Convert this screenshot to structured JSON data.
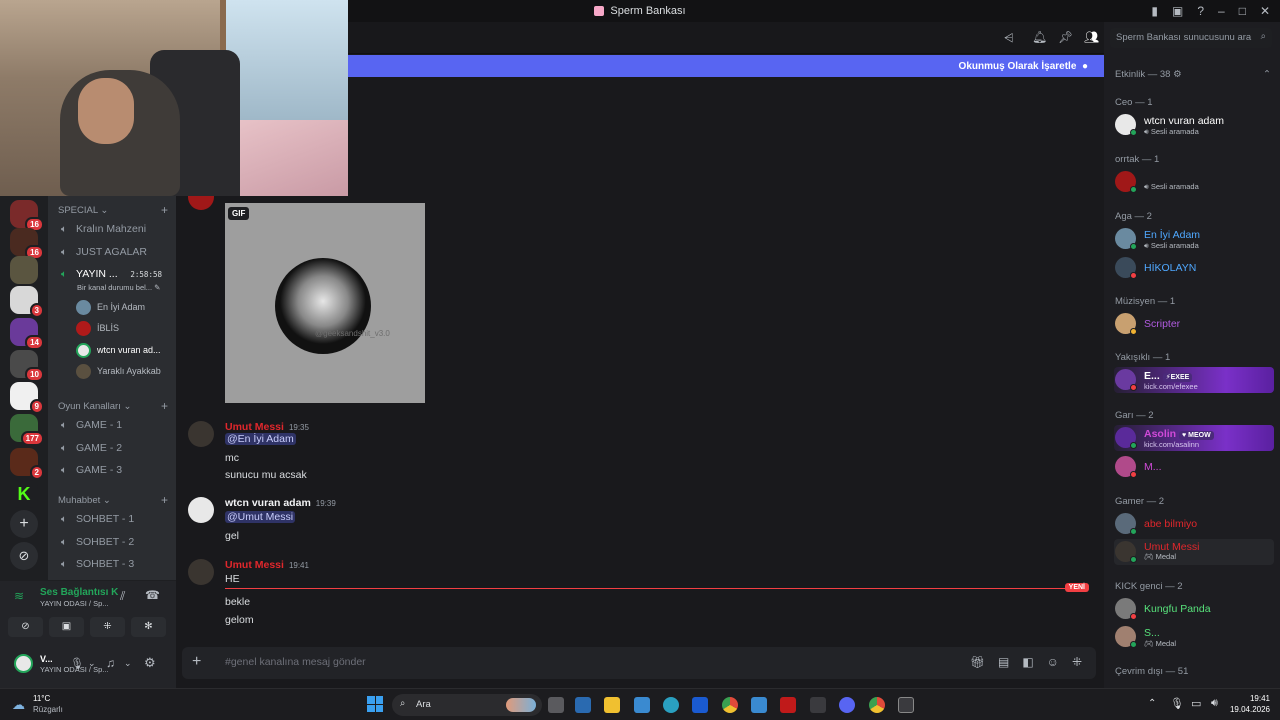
{
  "window": {
    "title": "Sperm Bankası"
  },
  "topbar": {
    "unread_banner": "Okunmuş Olarak İşaretle"
  },
  "servers": [
    {
      "badge": "16"
    },
    {
      "badge": "16"
    },
    {
      "badge": ""
    },
    {
      "badge": "3"
    },
    {
      "badge": "14"
    },
    {
      "badge": "10"
    },
    {
      "badge": "9"
    },
    {
      "badge": "177"
    },
    {
      "badge": "2"
    }
  ],
  "channels": {
    "cat_special": "SPECIAL",
    "kralin": "Kralın Mahzeni",
    "just": "JUST AGALAR",
    "yayin": "YAYIN ...",
    "yayin_time": "2:58:58",
    "yayin_status": "Bir kanal durumu bel...",
    "voice_users": [
      "En İyi Adam",
      "İBLİS",
      "wtcn vuran ad...",
      "Yaraklı Ayakkab"
    ],
    "cat_oyun": "Oyun Kanalları",
    "game1": "GAME - 1",
    "game2": "GAME - 2",
    "game3": "GAME - 3",
    "cat_muhabbet": "Muhabbet",
    "sohbet1": "SOHBET - 1",
    "sohbet2": "SOHBET - 2",
    "sohbet3": "SOHBET - 3"
  },
  "voice_panel": {
    "status": "Ses Bağlantısı K",
    "sub": "YAYIN ODASI / Sp...",
    "user": "V...",
    "user_sub": "S..."
  },
  "gif": {
    "label": "GIF",
    "watermark": "@geeksandshit_v3.0"
  },
  "messages": {
    "m1_name": "Umut Messi",
    "m1_time": "19:35",
    "m1_mention": "@En İyi Adam",
    "m1_l2": "mc",
    "m1_l3": "sunucu mu acsak",
    "m2_name": "wtcn vuran adam",
    "m2_time": "19:39",
    "m2_mention": "@Umut Messi",
    "m2_l2": "gel",
    "m3_name": "Umut Messi",
    "m3_time": "19:41",
    "m3_l1": "HE",
    "m3_l2": "bekle",
    "m3_l3": "gelom",
    "new_label": "YENİ"
  },
  "composer": {
    "placeholder": "#genel kanalına mesaj gönder"
  },
  "members": {
    "search": "Sperm Bankası sunucusunu ara",
    "etkinlik": "Etkinlik — 38",
    "ceo": "Ceo — 1",
    "ceo_user": "wtcn vuran adam",
    "sesli": "Sesli aramada",
    "orrtak": "orrtak — 1",
    "aga": "Aga — 2",
    "aga1": "En İyi Adam",
    "aga2": "HİKOLAYN",
    "muzisyen": "Müzisyen — 1",
    "scripter": "Scripter",
    "yakisikli": "Yakışıklı — 1",
    "yak_user": "E...",
    "yak_tag": "EXEE",
    "yak_sub": "kick.com/efexee",
    "gari": "Garı — 2",
    "gari1": "Asolin",
    "gari1_tag": "MEOW",
    "gari1_sub": "kick.com/asalinn",
    "gari2": "M...",
    "gamer": "Gamer — 2",
    "gamer1": "abe bilmiyo",
    "gamer2": "Umut Messi",
    "medal": "Medal",
    "kick": "KICK genci — 2",
    "kick1": "Kungfu Panda",
    "kick2": "S...",
    "offline": "Çevrim dışı — 51"
  },
  "taskbar": {
    "temp": "11°C",
    "weather": "Rüzgarlı",
    "search": "Ara",
    "time": "19:41",
    "date": "19.04.2026"
  },
  "colors": {
    "accent": "#5865f2",
    "red_name": "#e0272c",
    "blue_name": "#4fa8ff",
    "green_name": "#57e07a",
    "purple_name": "#b15be0"
  }
}
